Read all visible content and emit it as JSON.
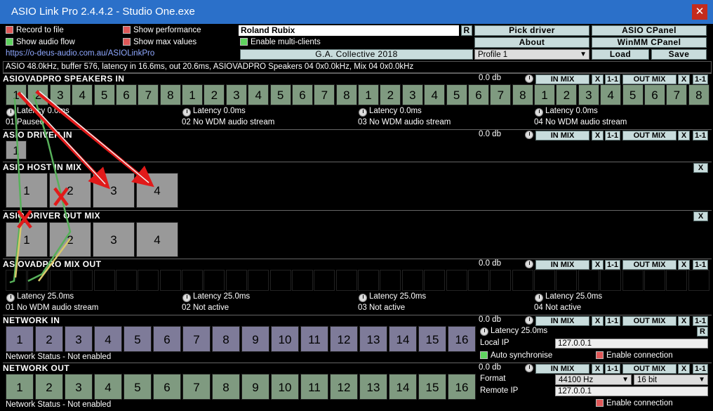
{
  "window": {
    "title": "ASIO Link Pro 2.4.4.2 - Studio One.exe",
    "close": "✕"
  },
  "options": {
    "record_to_file": "Record to file",
    "show_audio_flow": "Show audio flow",
    "show_performance": "Show performance",
    "show_max_values": "Show max values",
    "enable_multi_clients": "Enable multi-clients"
  },
  "website": "https://o-deus-audio.com.au/ASIOLinkPro",
  "device_name": "Roland Rubix",
  "r_label": "R",
  "buttons": {
    "pick_driver": "Pick driver",
    "asio_cpanel": "ASIO CPanel",
    "about": "About",
    "winmm_cpanel": "WinMM CPanel",
    "collective": "G.A. Collective 2018",
    "load": "Load",
    "save": "Save"
  },
  "profile": "Profile 1",
  "status_line": "ASIO 48.0kHz, buffer 576, latency in 16.6ms, out 20.6ms, ASIOVADPRO Speakers 04 0x0.0kHz, Mix 04 0x0.0kHz",
  "mix": {
    "in_mix": "IN MIX",
    "out_mix": "OUT MIX",
    "x": "X",
    "one_one": "1-1",
    "db": "0.0 db"
  },
  "speakers_in": {
    "title": "ASIOVADPRO SPEAKERS IN",
    "groups": [
      {
        "latency": "Latency 0.0ms",
        "status": "01 Paused"
      },
      {
        "latency": "Latency 0.0ms",
        "status": "02 No WDM audio stream"
      },
      {
        "latency": "Latency 0.0ms",
        "status": "03 No WDM audio stream"
      },
      {
        "latency": "Latency 0.0ms",
        "status": "04 No WDM audio stream"
      }
    ]
  },
  "driver_in": {
    "title": "ASIO DRIVER IN"
  },
  "host_in_mix": {
    "title": "ASIO HOST IN MIX"
  },
  "driver_out_mix": {
    "title": "ASIO DRIVER OUT MIX"
  },
  "mix_out": {
    "title": "ASIOVADPRO MIX OUT",
    "groups": [
      {
        "latency": "Latency 25.0ms",
        "status": "01 No WDM audio stream"
      },
      {
        "latency": "Latency 25.0ms",
        "status": "02 Not active"
      },
      {
        "latency": "Latency 25.0ms",
        "status": "03 Not active"
      },
      {
        "latency": "Latency 25.0ms",
        "status": "04 Not active"
      }
    ]
  },
  "network_in": {
    "title": "NETWORK IN",
    "status": "Network Status - Not enabled",
    "latency": "Latency 25.0ms",
    "local_ip_label": "Local IP",
    "local_ip": "127.0.0.1",
    "auto_sync": "Auto synchronise",
    "enable_connection": "Enable connection"
  },
  "network_out": {
    "title": "NETWORK OUT",
    "status": "Network Status - Not enabled",
    "format_label": "Format",
    "format": "44100 Hz",
    "bits": "16 bit",
    "remote_ip_label": "Remote IP",
    "remote_ip": "127.0.0.1",
    "enable_connection": "Enable connection"
  },
  "channels8": [
    "1",
    "2",
    "3",
    "4",
    "5",
    "6",
    "7",
    "8"
  ],
  "channels4": [
    "1",
    "2",
    "3",
    "4"
  ],
  "channels16": [
    "1",
    "2",
    "3",
    "4",
    "5",
    "6",
    "7",
    "8",
    "9",
    "10",
    "11",
    "12",
    "13",
    "14",
    "15",
    "16"
  ],
  "driver_in_channels": [
    "1"
  ],
  "colors": {
    "titlebar": "#2b70c9",
    "close": "#c42b1c",
    "arrow": "#e11a1a",
    "flow_green": "#57b05a",
    "flow_yellow": "#d8c86a"
  }
}
